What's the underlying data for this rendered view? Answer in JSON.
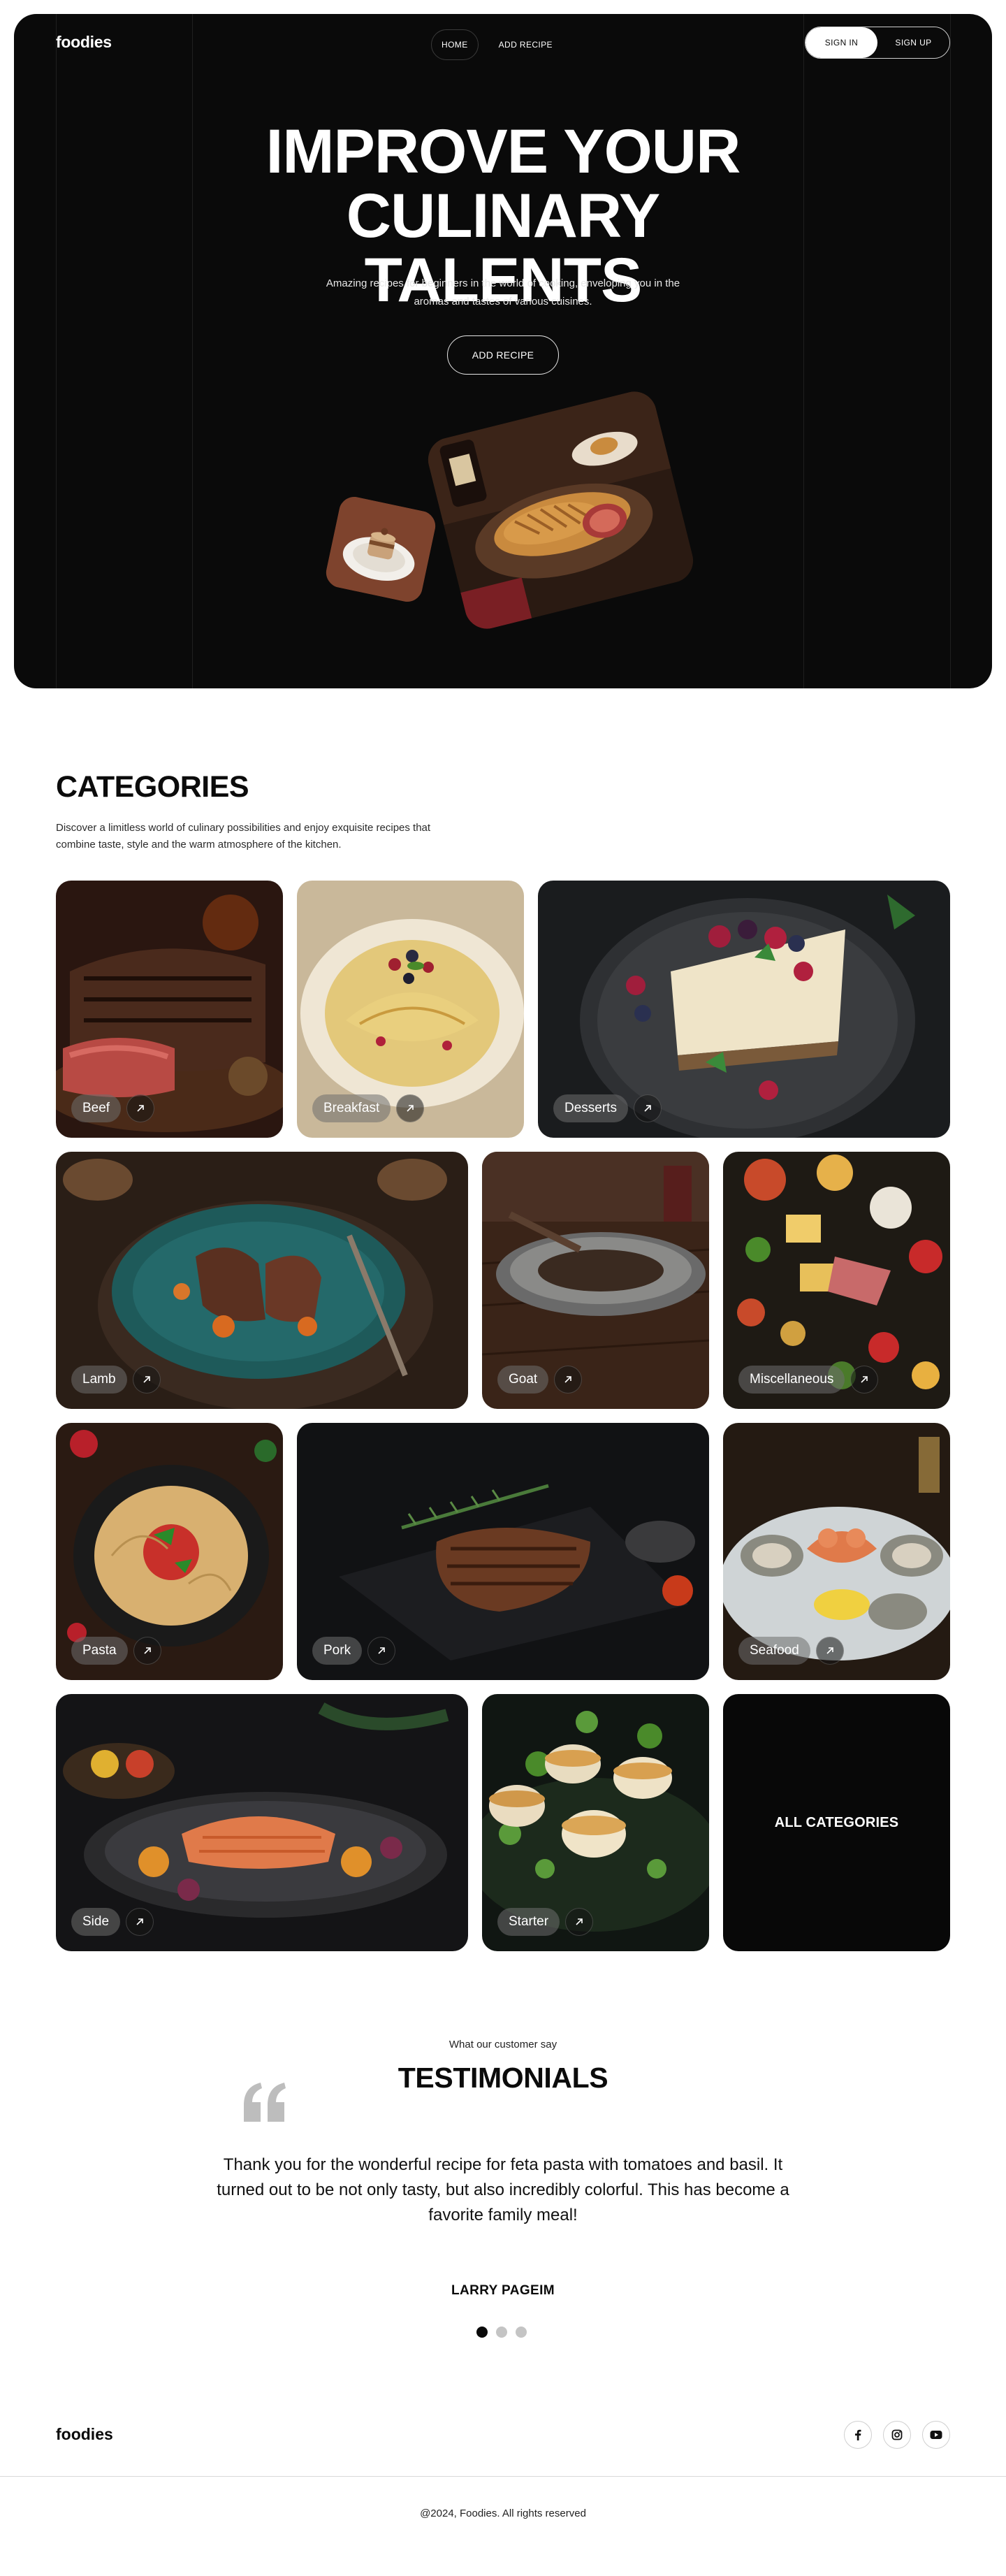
{
  "brand": {
    "logo": "foodies"
  },
  "nav": {
    "links": [
      {
        "label": "HOME",
        "active": true
      },
      {
        "label": "ADD RECIPE",
        "active": false
      }
    ],
    "sign_in": "SIGN IN",
    "sign_up": "SIGN UP"
  },
  "hero": {
    "title": "IMPROVE YOUR CULINARY TALENTS",
    "subtitle": "Amazing recipes for beginners in the world of cooking, enveloping you in the aromas and tastes of various cuisines.",
    "cta": "ADD RECIPE"
  },
  "categories": {
    "title": "CATEGORIES",
    "description": "Discover a limitless world of culinary possibilities and enjoy exquisite recipes that combine taste, style and the warm atmosphere of the kitchen.",
    "items": [
      {
        "label": "Beef"
      },
      {
        "label": "Breakfast"
      },
      {
        "label": "Desserts"
      },
      {
        "label": "Lamb"
      },
      {
        "label": "Goat"
      },
      {
        "label": "Miscellaneous"
      },
      {
        "label": "Pasta"
      },
      {
        "label": "Pork"
      },
      {
        "label": "Seafood"
      },
      {
        "label": "Side"
      },
      {
        "label": "Starter"
      }
    ],
    "all_label": "ALL CATEGORIES"
  },
  "testimonials": {
    "overline": "What our customer say",
    "title": "TESTIMONIALS",
    "quote": "Thank you for the wonderful recipe for feta pasta with tomatoes and basil. It turned out to be not only tasty, but also incredibly colorful. This has become a favorite family meal!",
    "author": "LARRY PAGEIM",
    "total_slides": 3,
    "active_slide": 1
  },
  "footer": {
    "logo": "foodies",
    "socials": [
      "facebook-icon",
      "instagram-icon",
      "youtube-icon"
    ],
    "copyright": "@2024, Foodies. All rights reserved"
  },
  "colors": {
    "hero_bg": "#0a0a0a",
    "text": "#0b0b0b",
    "accent_dark": "#080808",
    "dot_inactive": "#c4c4c4"
  }
}
